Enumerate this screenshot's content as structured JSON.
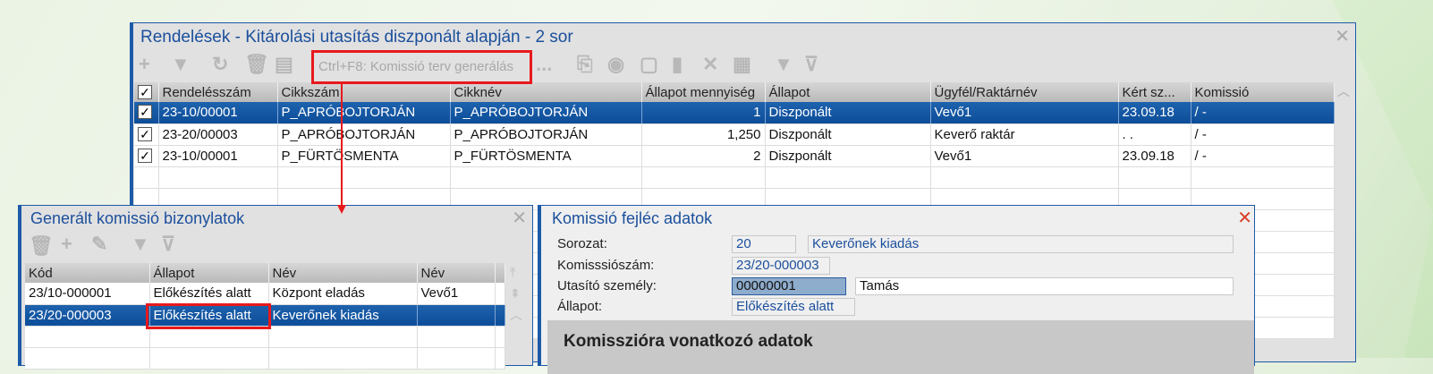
{
  "main": {
    "title": "Rendelések - Kitárolási utasítás diszponált alapján - 2 sor",
    "toolbar_hint": "Ctrl+F8: Komissió terv generálás",
    "more": "...",
    "columns": [
      "Rendelésszám",
      "Cikkszám",
      "Cikknév",
      "Állapot mennyiség",
      "Állapot",
      "Ügyfél/Raktárnév",
      "Kért sz...",
      "Komissió"
    ],
    "rows": [
      [
        "23-10/00001",
        "P_APRÓBOJTORJÁN",
        "P_APRÓBOJTORJÁN",
        "1",
        "Diszponált",
        "Vevő1",
        "23.09.18",
        "/  -"
      ],
      [
        "23-20/00003",
        "P_APRÓBOJTORJÁN",
        "P_APRÓBOJTORJÁN",
        "1,250",
        "Diszponált",
        "Keverő raktár",
        ".  .",
        "/  -"
      ],
      [
        "23-10/00001",
        "P_FÜRTÖSMENTA",
        "P_FÜRTÖSMENTA",
        "2",
        "Diszponált",
        "Vevő1",
        "23.09.18",
        "/  -"
      ]
    ]
  },
  "generated": {
    "title": "Generált komissió bizonylatok",
    "columns": [
      "Kód",
      "Állapot",
      "Név",
      "Név"
    ],
    "rows": [
      [
        "23/10-000001",
        "Előkészítés alatt",
        "Központ eladás",
        "Vevő1"
      ],
      [
        "23/20-000003",
        "Előkészítés alatt",
        "Keverőnek kiadás",
        ""
      ]
    ]
  },
  "header": {
    "title": "Komissió fejléc adatok",
    "sorozat_label": "Sorozat:",
    "sorozat_code": "20",
    "sorozat_name": "Keverőnek kiadás",
    "number_label": "Komisssiószám:",
    "number": "23/20-000003",
    "person_label": "Utasító személy:",
    "person_code": "00000001",
    "person_name": "Tamás",
    "status_label": "Állapot:",
    "status": "Előkészítés alatt",
    "section": "Komisszióra vonatkozó adatok"
  },
  "colors": {
    "accent": "#1b4f9c",
    "annotation": "#e8191c"
  }
}
